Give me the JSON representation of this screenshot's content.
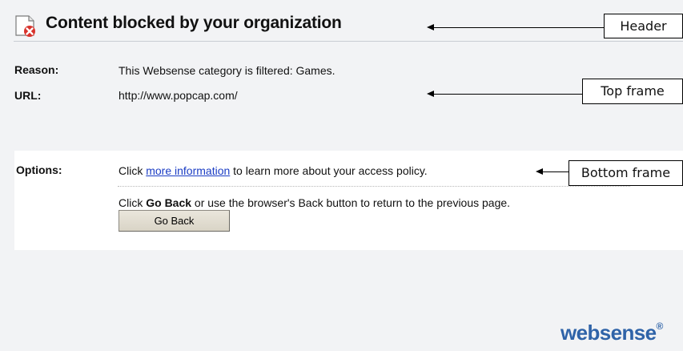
{
  "header": {
    "title": "Content blocked by your organization"
  },
  "top_frame": {
    "reason_label": "Reason:",
    "reason_value": "This Websense category is filtered: Games.",
    "url_label": "URL:",
    "url_value": "http://www.popcap.com/"
  },
  "bottom_frame": {
    "options_label": "Options:",
    "line1_prefix": "Click ",
    "line1_link": "more information",
    "line1_suffix": " to learn more about your access policy.",
    "line2_prefix": "Click ",
    "line2_bold": "Go Back",
    "line2_suffix": " or use the browser's Back button to return to the previous page.",
    "go_back_button": "Go Back"
  },
  "callouts": {
    "header": "Header",
    "top_frame": "Top frame",
    "bottom_frame": "Bottom frame"
  },
  "logo": {
    "part1": "web",
    "part2": "sense",
    "mark": "®"
  },
  "colors": {
    "link": "#1a3cc4",
    "logo": "#2f63a8",
    "page_bg": "#f2f3f5",
    "icon_x": "#d8322b"
  }
}
